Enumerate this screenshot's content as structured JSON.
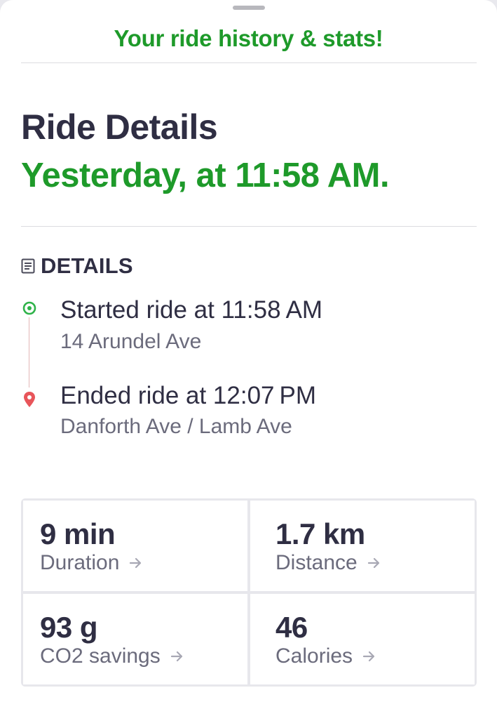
{
  "header": {
    "title": "Your ride history & stats!"
  },
  "ride": {
    "title": "Ride Details",
    "time": "Yesterday, at 11:58 AM."
  },
  "details": {
    "label": "DETAILS",
    "start": {
      "title": "Started ride at 11:58 AM",
      "address": "14 Arundel Ave",
      "icon": "start-pin-icon"
    },
    "end": {
      "title": "Ended ride at 12:07 PM",
      "address": "Danforth Ave / Lamb Ave",
      "icon": "end-pin-icon"
    }
  },
  "stats": [
    {
      "value": "9 min",
      "label": "Duration"
    },
    {
      "value": "1.7 km",
      "label": "Distance"
    },
    {
      "value": "93 g",
      "label": "CO2 savings"
    },
    {
      "value": "46",
      "label": "Calories"
    }
  ],
  "colors": {
    "accent_green": "#1e9a2a",
    "end_pin_red": "#e8555a",
    "text_dark": "#2f2e43",
    "text_muted": "#6b6b7c"
  }
}
